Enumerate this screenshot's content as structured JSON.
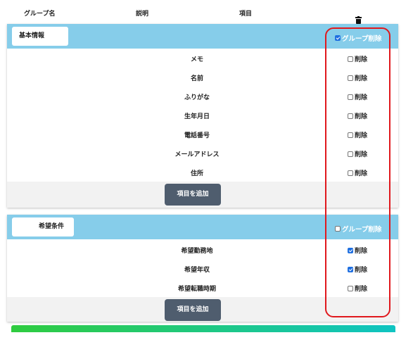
{
  "header": {
    "group_name": "グループ名",
    "description": "説明",
    "item": "項目",
    "delete_icon": "trash-icon"
  },
  "groups": [
    {
      "name": "基本情報",
      "group_delete_label": "グループ削除",
      "group_delete_checked": true,
      "items": [
        {
          "label": "メモ",
          "delete_label": "削除",
          "checked": false
        },
        {
          "label": "名前",
          "delete_label": "削除",
          "checked": false
        },
        {
          "label": "ふりがな",
          "delete_label": "削除",
          "checked": false
        },
        {
          "label": "生年月日",
          "delete_label": "削除",
          "checked": false
        },
        {
          "label": "電話番号",
          "delete_label": "削除",
          "checked": false
        },
        {
          "label": "メールアドレス",
          "delete_label": "削除",
          "checked": false
        },
        {
          "label": "住所",
          "delete_label": "削除",
          "checked": false
        }
      ],
      "add_button": "項目を追加"
    },
    {
      "name": "希望条件",
      "group_delete_label": "グループ削除",
      "group_delete_checked": false,
      "items": [
        {
          "label": "希望勤務地",
          "delete_label": "削除",
          "checked": true
        },
        {
          "label": "希望年収",
          "delete_label": "削除",
          "checked": true
        },
        {
          "label": "希望転職時期",
          "delete_label": "削除",
          "checked": false
        }
      ],
      "add_button": "項目を追加"
    }
  ],
  "colors": {
    "group_header": "#86cdea",
    "add_button": "#4f5d6e",
    "highlight": "#e0181d",
    "checkbox_checked": "#1f6fe0"
  }
}
